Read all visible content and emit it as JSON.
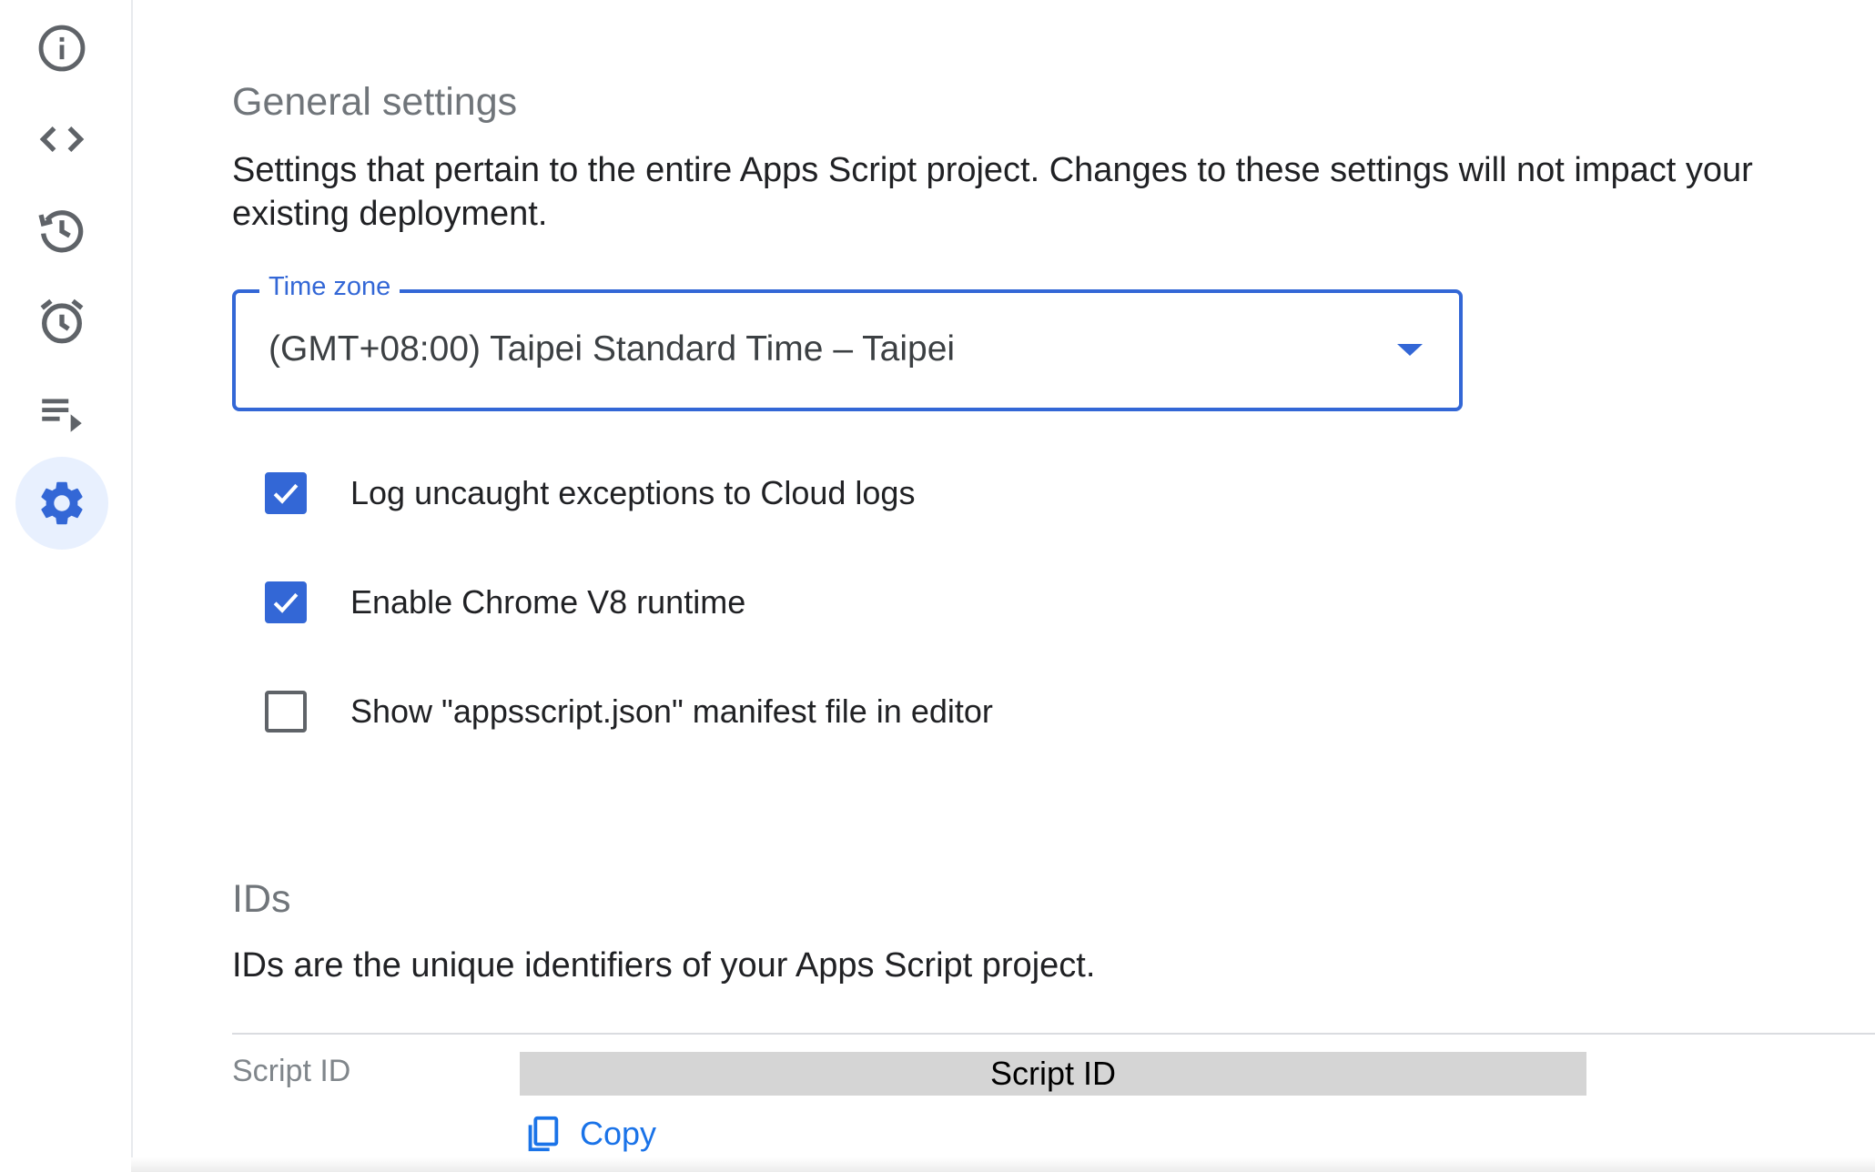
{
  "sidebar": {
    "items": [
      {
        "icon": "info-icon",
        "active": false
      },
      {
        "icon": "code-icon",
        "active": false
      },
      {
        "icon": "history-icon",
        "active": false
      },
      {
        "icon": "alarm-clock-icon",
        "active": false
      },
      {
        "icon": "executions-icon",
        "active": false
      },
      {
        "icon": "gear-icon",
        "active": true
      }
    ]
  },
  "general": {
    "title": "General settings",
    "description": "Settings that pertain to the entire Apps Script project. Changes to these settings will not impact your existing deployment.",
    "time_zone": {
      "label": "Time zone",
      "value": "(GMT+08:00) Taipei Standard Time – Taipei"
    },
    "options": [
      {
        "label": "Log uncaught exceptions to Cloud logs",
        "checked": true
      },
      {
        "label": "Enable Chrome V8 runtime",
        "checked": true
      },
      {
        "label": "Show \"appsscript.json\" manifest file in editor",
        "checked": false
      }
    ]
  },
  "ids": {
    "title": "IDs",
    "description": "IDs are the unique identifiers of your Apps Script project.",
    "script_id_label": "Script ID",
    "script_id_value": "Script ID",
    "copy_label": "Copy"
  },
  "colors": {
    "accent": "#3367d6",
    "link": "#1a73e8",
    "active_bg": "#e8f0fe",
    "icon_gray": "#5f6368",
    "muted_text": "#70757a"
  }
}
